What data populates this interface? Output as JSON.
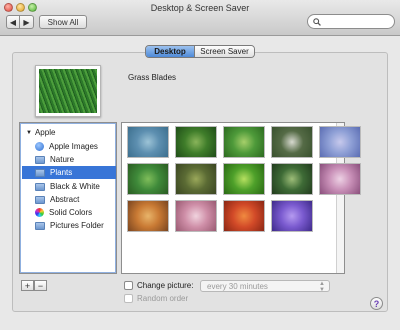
{
  "window": {
    "title": "Desktop & Screen Saver"
  },
  "toolbar": {
    "back_glyph": "◀",
    "forward_glyph": "▶",
    "show_all_label": "Show All",
    "search_placeholder": ""
  },
  "tabs": [
    {
      "label": "Desktop",
      "active": true
    },
    {
      "label": "Screen Saver",
      "active": false
    }
  ],
  "current_picture": {
    "name": "Grass Blades"
  },
  "sidebar": {
    "group_label": "Apple",
    "items": [
      {
        "label": "Apple Images",
        "icon": "apple-images-icon",
        "selected": false
      },
      {
        "label": "Nature",
        "icon": "folder-icon",
        "selected": false
      },
      {
        "label": "Plants",
        "icon": "folder-icon",
        "selected": true
      },
      {
        "label": "Black & White",
        "icon": "folder-icon",
        "selected": false
      },
      {
        "label": "Abstract",
        "icon": "folder-icon",
        "selected": false
      },
      {
        "label": "Solid Colors",
        "icon": "color-wheel-icon",
        "selected": false
      },
      {
        "label": "Pictures Folder",
        "icon": "folder-icon",
        "selected": false
      }
    ],
    "add_label": "+",
    "remove_label": "−"
  },
  "thumbnails": [
    {
      "colors": [
        "#5d8fb0",
        "#9cc3d6",
        "#3c6f8e"
      ]
    },
    {
      "colors": [
        "#3f7d2a",
        "#89b45a",
        "#1f4d18"
      ]
    },
    {
      "colors": [
        "#4e9a3a",
        "#a6cf6a",
        "#2c6a20"
      ]
    },
    {
      "colors": [
        "#556b46",
        "#d7d9cf",
        "#39512e"
      ]
    },
    {
      "colors": [
        "#8fa0d6",
        "#c7c9ec",
        "#5b6db3"
      ]
    },
    {
      "colors": [
        "#3f8a3a",
        "#7fbd5a",
        "#2a5c22"
      ]
    },
    {
      "colors": [
        "#5b6b34",
        "#9aa85a",
        "#3b4622"
      ]
    },
    {
      "colors": [
        "#4ea02a",
        "#b6e060",
        "#2a6a14"
      ]
    },
    {
      "colors": [
        "#3e6b36",
        "#9dbd78",
        "#223c1e"
      ]
    },
    {
      "colors": [
        "#c88fb7",
        "#edd1e4",
        "#8a4f7c"
      ]
    },
    {
      "colors": [
        "#c97a34",
        "#e8b46a",
        "#7a4520"
      ]
    },
    {
      "colors": [
        "#cf8fa8",
        "#f0d3de",
        "#9a5a72"
      ]
    },
    {
      "colors": [
        "#d24a28",
        "#f08a40",
        "#8a2614"
      ]
    },
    {
      "colors": [
        "#7a5acf",
        "#b59af0",
        "#3e2a8a"
      ]
    }
  ],
  "options": {
    "change_picture_label": "Change picture:",
    "interval_value": "every 30 minutes",
    "random_order_label": "Random order"
  },
  "help_label": "?"
}
